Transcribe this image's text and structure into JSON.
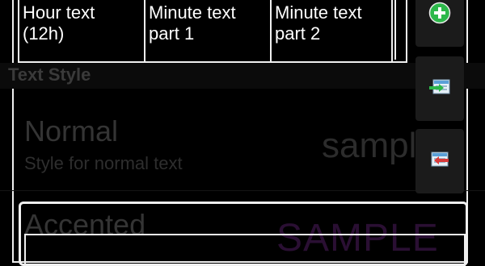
{
  "columns": {
    "hour": "Hour text\n(12h)",
    "minute1": "Minute text\npart 1",
    "minute2": "Minute text\npart 2"
  },
  "section": {
    "header": "Text Style"
  },
  "styles": [
    {
      "title": "Normal",
      "subtitle": "Style for normal text",
      "sample": "sample"
    },
    {
      "title": "Accented",
      "sample": "SAMPLE"
    }
  ],
  "colors": {
    "add_green": "#2db84a",
    "accent_purple": "#2a0f33"
  },
  "icons": {
    "add": "plus-circle-icon",
    "import": "import-icon",
    "export": "export-icon"
  }
}
